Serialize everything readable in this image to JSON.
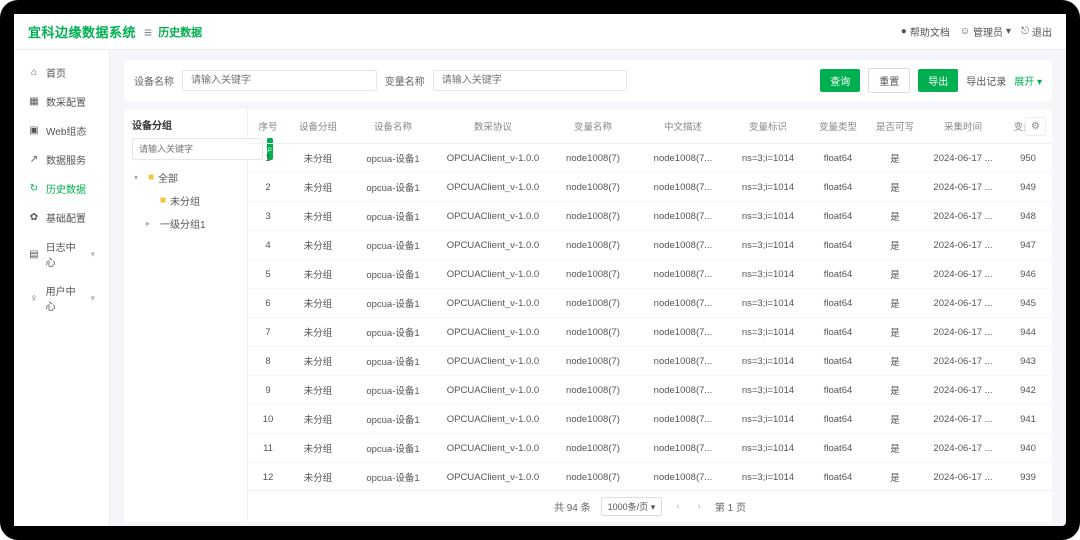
{
  "header": {
    "brand": "宜科边缘数据系统",
    "breadcrumb": "历史数据",
    "help": "帮助文档",
    "user": "管理员",
    "logout": "退出"
  },
  "sidebar": {
    "items": [
      {
        "icon": "⌂",
        "label": "首页"
      },
      {
        "icon": "▦",
        "label": "数采配置"
      },
      {
        "icon": "▣",
        "label": "Web组态"
      },
      {
        "icon": "↗",
        "label": "数据服务"
      },
      {
        "icon": "↻",
        "label": "历史数据",
        "active": true
      },
      {
        "icon": "✿",
        "label": "基础配置"
      },
      {
        "icon": "▤",
        "label": "日志中心",
        "expandable": true
      },
      {
        "icon": "♀",
        "label": "用户中心",
        "expandable": true
      }
    ]
  },
  "searchbar": {
    "label1": "设备名称",
    "label2": "变量名称",
    "placeholder": "请输入关键字",
    "query": "查询",
    "reset": "重置",
    "export": "导出",
    "exportLog": "导出记录",
    "expand": "展开"
  },
  "tree": {
    "title": "设备分组",
    "placeholder": "请输入关键字",
    "nodes": [
      {
        "label": "全部",
        "level": 0,
        "folder": true,
        "open": true
      },
      {
        "label": "未分组",
        "level": 1,
        "folder": true
      },
      {
        "label": "一级分组1",
        "level": 1,
        "expandable": true
      }
    ]
  },
  "table": {
    "columns": [
      "序号",
      "设备分组",
      "设备名称",
      "数采协议",
      "变量名称",
      "中文描述",
      "变量标识",
      "变量类型",
      "是否可写",
      "采集时间",
      "变量值"
    ],
    "colWidths": [
      "40",
      "60",
      "90",
      "110",
      "90",
      "90",
      "80",
      "60",
      "54",
      "82",
      "48"
    ],
    "rows": [
      [
        "1",
        "未分组",
        "opcua-设备1",
        "OPCUAClient_v-1.0.0",
        "node1008(7)",
        "node1008(7...",
        "ns=3;i=1014",
        "float64",
        "是",
        "2024-06-17 ...",
        "950"
      ],
      [
        "2",
        "未分组",
        "opcua-设备1",
        "OPCUAClient_v-1.0.0",
        "node1008(7)",
        "node1008(7...",
        "ns=3;i=1014",
        "float64",
        "是",
        "2024-06-17 ...",
        "949"
      ],
      [
        "3",
        "未分组",
        "opcua-设备1",
        "OPCUAClient_v-1.0.0",
        "node1008(7)",
        "node1008(7...",
        "ns=3;i=1014",
        "float64",
        "是",
        "2024-06-17 ...",
        "948"
      ],
      [
        "4",
        "未分组",
        "opcua-设备1",
        "OPCUAClient_v-1.0.0",
        "node1008(7)",
        "node1008(7...",
        "ns=3;i=1014",
        "float64",
        "是",
        "2024-06-17 ...",
        "947"
      ],
      [
        "5",
        "未分组",
        "opcua-设备1",
        "OPCUAClient_v-1.0.0",
        "node1008(7)",
        "node1008(7...",
        "ns=3;i=1014",
        "float64",
        "是",
        "2024-06-17 ...",
        "946"
      ],
      [
        "6",
        "未分组",
        "opcua-设备1",
        "OPCUAClient_v-1.0.0",
        "node1008(7)",
        "node1008(7...",
        "ns=3;i=1014",
        "float64",
        "是",
        "2024-06-17 ...",
        "945"
      ],
      [
        "7",
        "未分组",
        "opcua-设备1",
        "OPCUAClient_v-1.0.0",
        "node1008(7)",
        "node1008(7...",
        "ns=3;i=1014",
        "float64",
        "是",
        "2024-06-17 ...",
        "944"
      ],
      [
        "8",
        "未分组",
        "opcua-设备1",
        "OPCUAClient_v-1.0.0",
        "node1008(7)",
        "node1008(7...",
        "ns=3;i=1014",
        "float64",
        "是",
        "2024-06-17 ...",
        "943"
      ],
      [
        "9",
        "未分组",
        "opcua-设备1",
        "OPCUAClient_v-1.0.0",
        "node1008(7)",
        "node1008(7...",
        "ns=3;i=1014",
        "float64",
        "是",
        "2024-06-17 ...",
        "942"
      ],
      [
        "10",
        "未分组",
        "opcua-设备1",
        "OPCUAClient_v-1.0.0",
        "node1008(7)",
        "node1008(7...",
        "ns=3;i=1014",
        "float64",
        "是",
        "2024-06-17 ...",
        "941"
      ],
      [
        "11",
        "未分组",
        "opcua-设备1",
        "OPCUAClient_v-1.0.0",
        "node1008(7)",
        "node1008(7...",
        "ns=3;i=1014",
        "float64",
        "是",
        "2024-06-17 ...",
        "940"
      ],
      [
        "12",
        "未分组",
        "opcua-设备1",
        "OPCUAClient_v-1.0.0",
        "node1008(7)",
        "node1008(7...",
        "ns=3;i=1014",
        "float64",
        "是",
        "2024-06-17 ...",
        "939"
      ]
    ]
  },
  "pager": {
    "total": "共 94 条",
    "pageSize": "1000条/页",
    "pageText": "第 1 页"
  }
}
